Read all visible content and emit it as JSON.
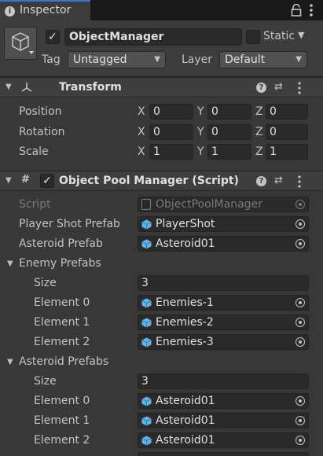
{
  "tab": {
    "icon": "info-icon",
    "label": "Inspector"
  },
  "header": {
    "name": "ObjectManager",
    "active": true,
    "static_label": "Static",
    "static_checked": false,
    "tag_label": "Tag",
    "tag_value": "Untagged",
    "layer_label": "Layer",
    "layer_value": "Default"
  },
  "transform": {
    "title": "Transform",
    "position": {
      "label": "Position",
      "x": "0",
      "y": "0",
      "z": "0"
    },
    "rotation": {
      "label": "Rotation",
      "x": "0",
      "y": "0",
      "z": "0"
    },
    "scale": {
      "label": "Scale",
      "x": "1",
      "y": "1",
      "z": "1"
    },
    "axis_x": "X",
    "axis_y": "Y",
    "axis_z": "Z"
  },
  "pool": {
    "title": "Object Pool Manager (Script)",
    "enabled": true,
    "script_label": "Script",
    "script_value": "ObjectPoolManager",
    "player_shot_label": "Player Shot Prefab",
    "player_shot_value": "PlayerShot",
    "asteroid_label": "Asteroid Prefab",
    "asteroid_value": "Asteroid01",
    "enemy_prefabs": {
      "label": "Enemy Prefabs",
      "size_label": "Size",
      "size": "3",
      "elements": [
        {
          "label": "Element 0",
          "value": "Enemies-1"
        },
        {
          "label": "Element 1",
          "value": "Enemies-2"
        },
        {
          "label": "Element 2",
          "value": "Enemies-3"
        }
      ]
    },
    "asteroid_prefabs": {
      "label": "Asteroid Prefabs",
      "size_label": "Size",
      "size": "3",
      "elements": [
        {
          "label": "Element 0",
          "value": "Asteroid01"
        },
        {
          "label": "Element 1",
          "value": "Asteroid01"
        },
        {
          "label": "Element 2",
          "value": "Asteroid01"
        }
      ]
    }
  },
  "colors": {
    "tab_accent": "#3a79bb",
    "background": "#383838",
    "field": "#2a2a2a",
    "prefab_cube": "#5fb3e8"
  }
}
